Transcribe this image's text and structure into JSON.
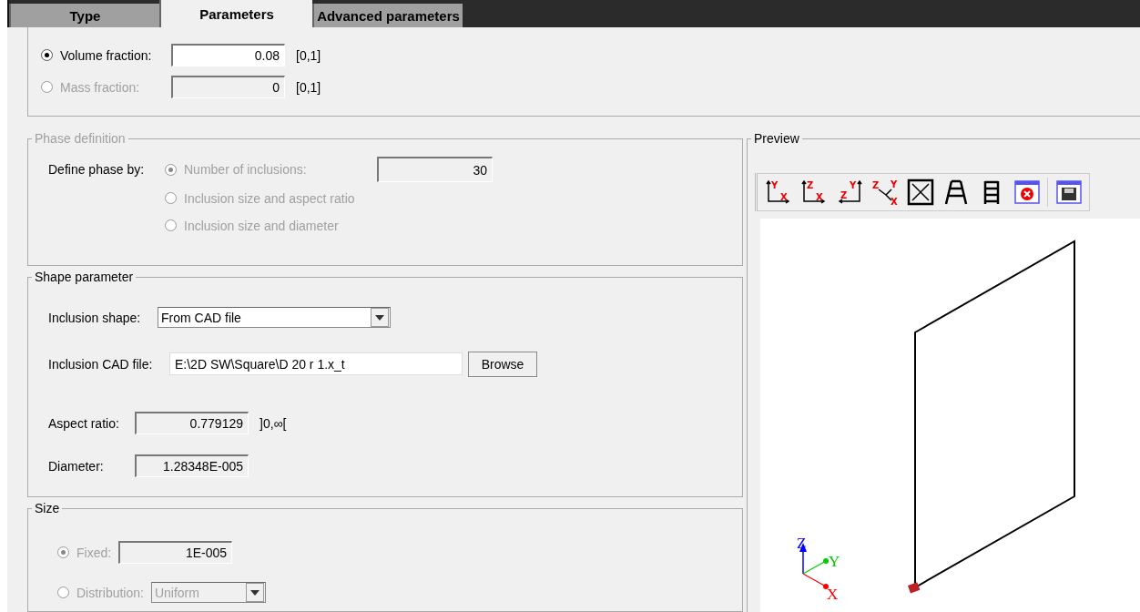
{
  "tabs": [
    {
      "label": "Type",
      "selected": false
    },
    {
      "label": "Parameters",
      "selected": true
    },
    {
      "label": "Advanced parameters",
      "selected": false
    }
  ],
  "fraction": {
    "options": [
      {
        "label": "Volume fraction:",
        "selected": true,
        "disabled": false,
        "value": "0.08",
        "range": "[0,1]"
      },
      {
        "label": "Mass fraction:",
        "selected": false,
        "disabled": true,
        "value": "0",
        "range": "[0,1]"
      }
    ]
  },
  "phase_definition": {
    "title": "Phase definition",
    "disabled": true,
    "label": "Define phase by:",
    "options": [
      {
        "label": "Number of inclusions:",
        "selected": true,
        "value": "30"
      },
      {
        "label": "Inclusion size and aspect ratio",
        "selected": false
      },
      {
        "label": "Inclusion size and diameter",
        "selected": false
      }
    ]
  },
  "shape_parameter": {
    "title": "Shape parameter",
    "inclusion_shape": {
      "label": "Inclusion shape:",
      "value": "From CAD file"
    },
    "cad_file": {
      "label": "Inclusion CAD file:",
      "value": "E:\\2D SW\\Square\\D 20 r 1.x_t",
      "button": "Browse"
    },
    "aspect_ratio": {
      "label": "Aspect ratio:",
      "value": "0.779129",
      "range": "]0,∞["
    },
    "diameter": {
      "label": "Diameter:",
      "value": "1.28348E-005"
    }
  },
  "size": {
    "title": "Size",
    "disabled": true,
    "options": [
      {
        "label": "Fixed:",
        "selected": true,
        "kind": "field",
        "value": "1E-005"
      },
      {
        "label": "Distribution:",
        "selected": false,
        "kind": "dropdown",
        "value": "Uniform"
      }
    ]
  },
  "preview": {
    "title": "Preview",
    "tools": [
      {
        "kind": "axes",
        "labels": [
          "Y",
          "X"
        ]
      },
      {
        "kind": "axes",
        "labels": [
          "Z",
          "X"
        ]
      },
      {
        "kind": "axes_left",
        "labels": [
          "Y",
          "Z"
        ]
      },
      {
        "kind": "axes_3d",
        "labels": [
          "Z",
          "Y",
          "X"
        ]
      },
      {
        "kind": "fit"
      },
      {
        "kind": "perspective"
      },
      {
        "kind": "parallel"
      },
      {
        "kind": "close"
      },
      {
        "kind": "save"
      }
    ],
    "axes": [
      "Z",
      "Y",
      "X"
    ]
  }
}
